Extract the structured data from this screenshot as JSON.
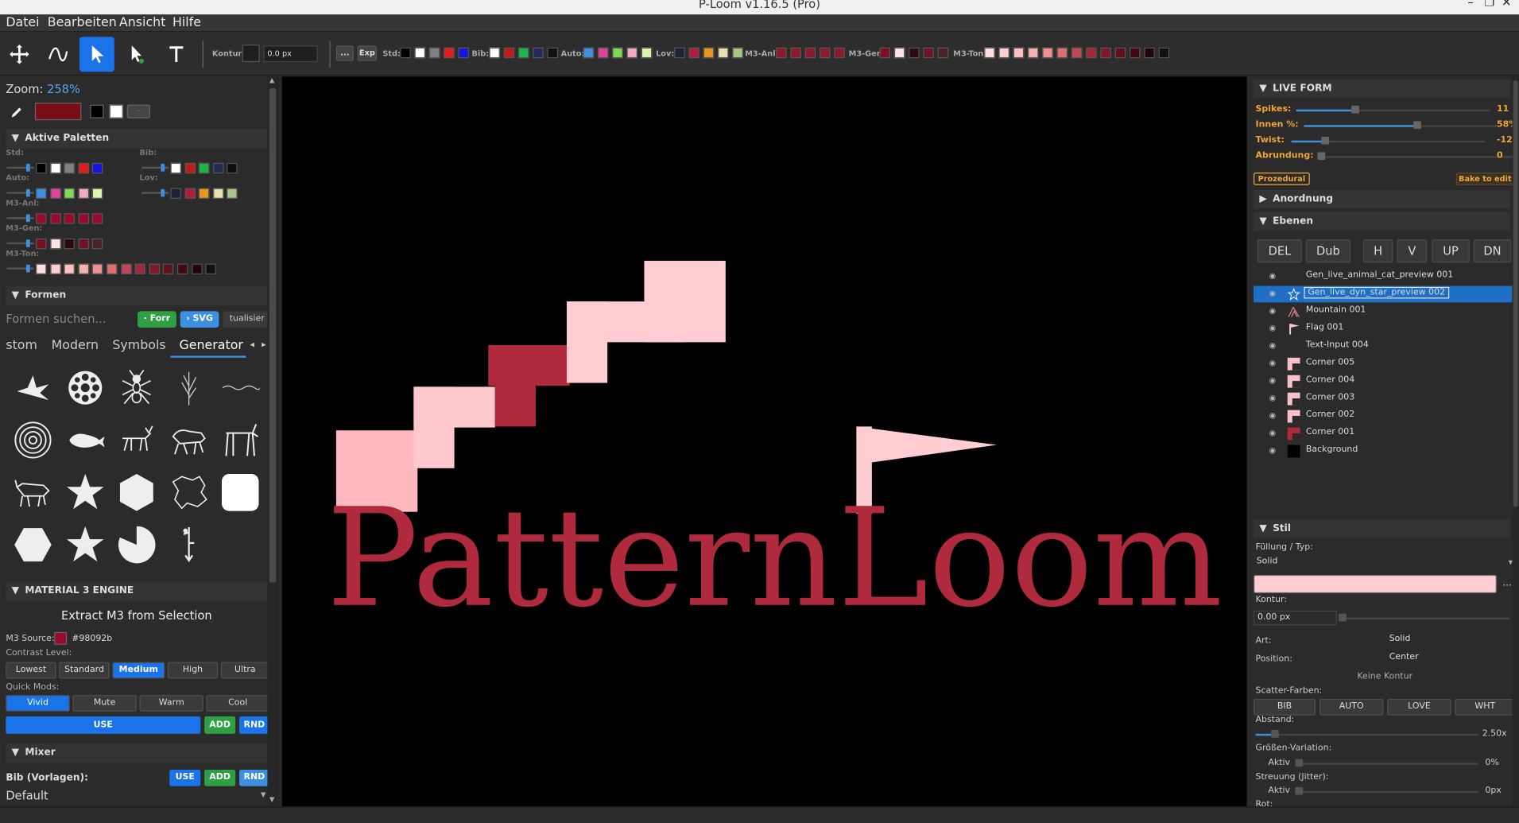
{
  "window": {
    "title": "P-Loom v1.16.5 (Pro)",
    "min": "–",
    "max": "❐",
    "close": "✕"
  },
  "menu": [
    "Datei",
    "Bearbeiten",
    "Ansicht",
    "Hilfe"
  ],
  "toolbar": {
    "tools": [
      {
        "name": "add-tool",
        "icon": "plus-move-icon",
        "active": false
      },
      {
        "name": "curve-tool",
        "icon": "curve-icon",
        "active": false
      },
      {
        "name": "select-tool",
        "icon": "cursor-icon",
        "active": true
      },
      {
        "name": "node-tool",
        "icon": "node-cursor-icon",
        "active": false
      },
      {
        "name": "text-tool",
        "icon": "text-icon",
        "active": false
      }
    ],
    "kontur_label": "Kontur:",
    "kontur_value": "0.0 px",
    "more_label": "...",
    "exp_label": "Exp",
    "palettes": [
      {
        "label": "Std:",
        "colors": [
          "#000000",
          "#ffffff",
          "#808080",
          "#e21b1b",
          "#1515e0"
        ]
      },
      {
        "label": "Bib:",
        "colors": [
          "#ffffff",
          "#c01a1a",
          "#1db54a",
          "#222a5a",
          "#101010"
        ]
      },
      {
        "label": "Auto:",
        "colors": [
          "#3f8fe0",
          "#e0449a",
          "#7ed957",
          "#f7a7c8",
          "#d9f7b0"
        ]
      },
      {
        "label": "Lov:",
        "colors": [
          "#1a2236",
          "#b01c3a",
          "#e8961e",
          "#e8e0b0",
          "#a8c888"
        ]
      },
      {
        "label": "M3-Anl:",
        "colors": [
          "#8b1a2b",
          "#8b1a2b",
          "#8b1a2b",
          "#8b1a2b",
          "#8b1a2b"
        ]
      },
      {
        "label": "M3-Gen:",
        "colors": [
          "#7a1020",
          "#fde3e3",
          "#2a0a0c",
          "#6e1424",
          "#4a2424"
        ]
      },
      {
        "label": "M3-Ton:",
        "colors": [
          "#ffe0e0",
          "#ffd0d0",
          "#ffc0c0",
          "#f8b0b0",
          "#f09090",
          "#e07070",
          "#c04858",
          "#a02838",
          "#801828",
          "#601018",
          "#400810",
          "#200408",
          "#101010"
        ]
      }
    ]
  },
  "left": {
    "zoom_label": "Zoom:",
    "zoom_value": "258%",
    "current_color": "#7a0d1a",
    "aktive_paletten": "Aktive Paletten",
    "palette_rows": [
      {
        "label": "Std:",
        "colors": [
          "#000000",
          "#ffffff",
          "#808080",
          "#e21b1b",
          "#1515e0"
        ]
      },
      {
        "label": "Bib:",
        "colors": [
          "#ffffff",
          "#c01a1a",
          "#1db54a",
          "#222a5a",
          "#101010"
        ]
      },
      {
        "label": "Auto:",
        "colors": [
          "#3f8fe0",
          "#e0449a",
          "#7ed957",
          "#f7a7c8",
          "#d9f7b0"
        ]
      },
      {
        "label": "Lov:",
        "colors": [
          "#1a2236",
          "#b01c3a",
          "#e8961e",
          "#e8e0b0",
          "#a8c888"
        ]
      },
      {
        "label": "M3-Anl:",
        "colors": [
          "#98092b",
          "#98092b",
          "#98092b",
          "#98092b",
          "#98092b"
        ]
      },
      {
        "label": "M3-Gen:",
        "colors": [
          "#7a1020",
          "#fde3e3",
          "#2a0a0c",
          "#6e1424",
          "#4a2424"
        ]
      },
      {
        "label": "M3-Ton:",
        "colors": [
          "#ffe0e0",
          "#ffd0d0",
          "#ffc0c0",
          "#f8b0b0",
          "#f09090",
          "#e07070",
          "#c04858",
          "#a02838",
          "#801828",
          "#601018",
          "#400810",
          "#200408",
          "#101010"
        ]
      }
    ],
    "formen": "Formen",
    "search_placeholder": "Formen suchen...",
    "btn_form": "· Forr",
    "btn_svg": "› SVG",
    "btn_update": "tualisier",
    "tabs": [
      "stom",
      "Modern",
      "Symbols",
      "Generator"
    ],
    "active_tab": "Generator",
    "material": "MATERIAL 3 ENGINE",
    "extract": "Extract M3 from Selection",
    "m3_source_label": "M3 Source:",
    "m3_source_value": "#98092b",
    "contrast_label": "Contrast Level:",
    "contrast": [
      "Lowest",
      "Standard",
      "Medium",
      "High",
      "Ultra"
    ],
    "contrast_active": "Medium",
    "quick_label": "Quick Mods:",
    "quick": [
      "Vivid",
      "Mute",
      "Warm",
      "Cool"
    ],
    "quick_active": "Vivid",
    "use": "USE",
    "add": "ADD",
    "rnd": "RND",
    "mixer": "Mixer",
    "bib_label": "Bib (Vorlagen):",
    "default": "Default"
  },
  "canvas": {
    "title_text": "PatternLoom",
    "accent": "#b02a3e",
    "pink": "#ffcdd2"
  },
  "right": {
    "live_form": "LIVE FORM",
    "sliders": [
      {
        "label": "Spikes:",
        "value": "11",
        "fraction": 0.3
      },
      {
        "label": "Innen %:",
        "value": "58%",
        "fraction": 0.58
      },
      {
        "label": "Twist:",
        "value": "-12",
        "fraction": 0.17
      },
      {
        "label": "Abrundung:",
        "value": "0",
        "fraction": 0.0
      }
    ],
    "prozedural": "Prozedural",
    "bake": "Bake to edit",
    "anordnung": "Anordnung",
    "ebenen": "Ebenen",
    "layer_buttons": [
      "DEL",
      "Dub",
      "H",
      "V",
      "UP",
      "DN"
    ],
    "layers": [
      {
        "name": "Gen_live_animal_cat_preview 001",
        "thumb": "",
        "selected": false
      },
      {
        "name": "Gen_live_dyn_star_preview 002",
        "thumb": "star",
        "selected": true
      },
      {
        "name": "Mountain 001",
        "thumb": "mountain",
        "selected": false
      },
      {
        "name": "Flag 001",
        "thumb": "flag",
        "selected": false
      },
      {
        "name": "Text-Input 004",
        "thumb": "",
        "selected": false
      },
      {
        "name": "Corner 005",
        "thumb": "#f8c0c8",
        "selected": false
      },
      {
        "name": "Corner 004",
        "thumb": "#f8c0c8",
        "selected": false
      },
      {
        "name": "Corner 003",
        "thumb": "#f8c0c8",
        "selected": false
      },
      {
        "name": "Corner 002",
        "thumb": "#f8c0c8",
        "selected": false
      },
      {
        "name": "Corner 001",
        "thumb": "#b02a3e",
        "selected": false
      },
      {
        "name": "Background",
        "thumb": "#000000",
        "selected": false
      }
    ],
    "stil": "Stil",
    "fill_label": "Füllung / Typ:",
    "fill_value": "Solid",
    "fill_color": "#ffcdd2",
    "more": "...",
    "kontur_label": "Kontur:",
    "kontur_value": "0.00 px",
    "art_label": "Art:",
    "art_value": "Solid",
    "position_label": "Position:",
    "position_value": "Center",
    "keine_kontur": "Keine Kontur",
    "scatter_label": "Scatter-Farben:",
    "scatter": [
      "BIB",
      "AUTO",
      "LOVE",
      "WHT"
    ],
    "abstand_label": "Abstand:",
    "abstand_value": "2.50x",
    "groessen_label": "Größen-Variation:",
    "aktiv": "Aktiv",
    "groessen_value": "0%",
    "streuung_label": "Streuung (Jitter):",
    "streuung_value": "0px",
    "rot_label": "Rot:"
  }
}
